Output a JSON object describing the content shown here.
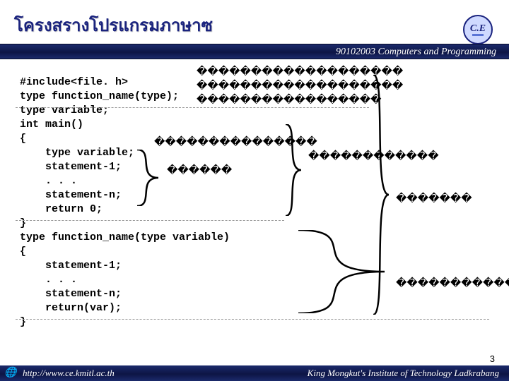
{
  "title": "โครงสรางโปรแกรมภาษาซ",
  "header_bar": "90102003 Computers and Programming",
  "code": "#include<file. h>\ntype function_name(type);\ntype variable;\nint main()\n{\n    type variable;\n    statement-1;\n    . . .\n    statement-n;\n    return 0;\n}\ntype function_name(type variable)\n{\n    statement-1;\n    . . .\n    statement-n;\n    return(var);\n}",
  "annotations": {
    "a1": "�������������������",
    "a2": "�������������������",
    "a3": "�����������������",
    "a4": "���������������",
    "a5": "������",
    "a6": "������������",
    "a7": "�������",
    "a8": "������������"
  },
  "footer_left": "http://www.ce.kmitl.ac.th",
  "footer_right": "King Mongkut's Institute of Technology Ladkrabang",
  "page_number": "3"
}
